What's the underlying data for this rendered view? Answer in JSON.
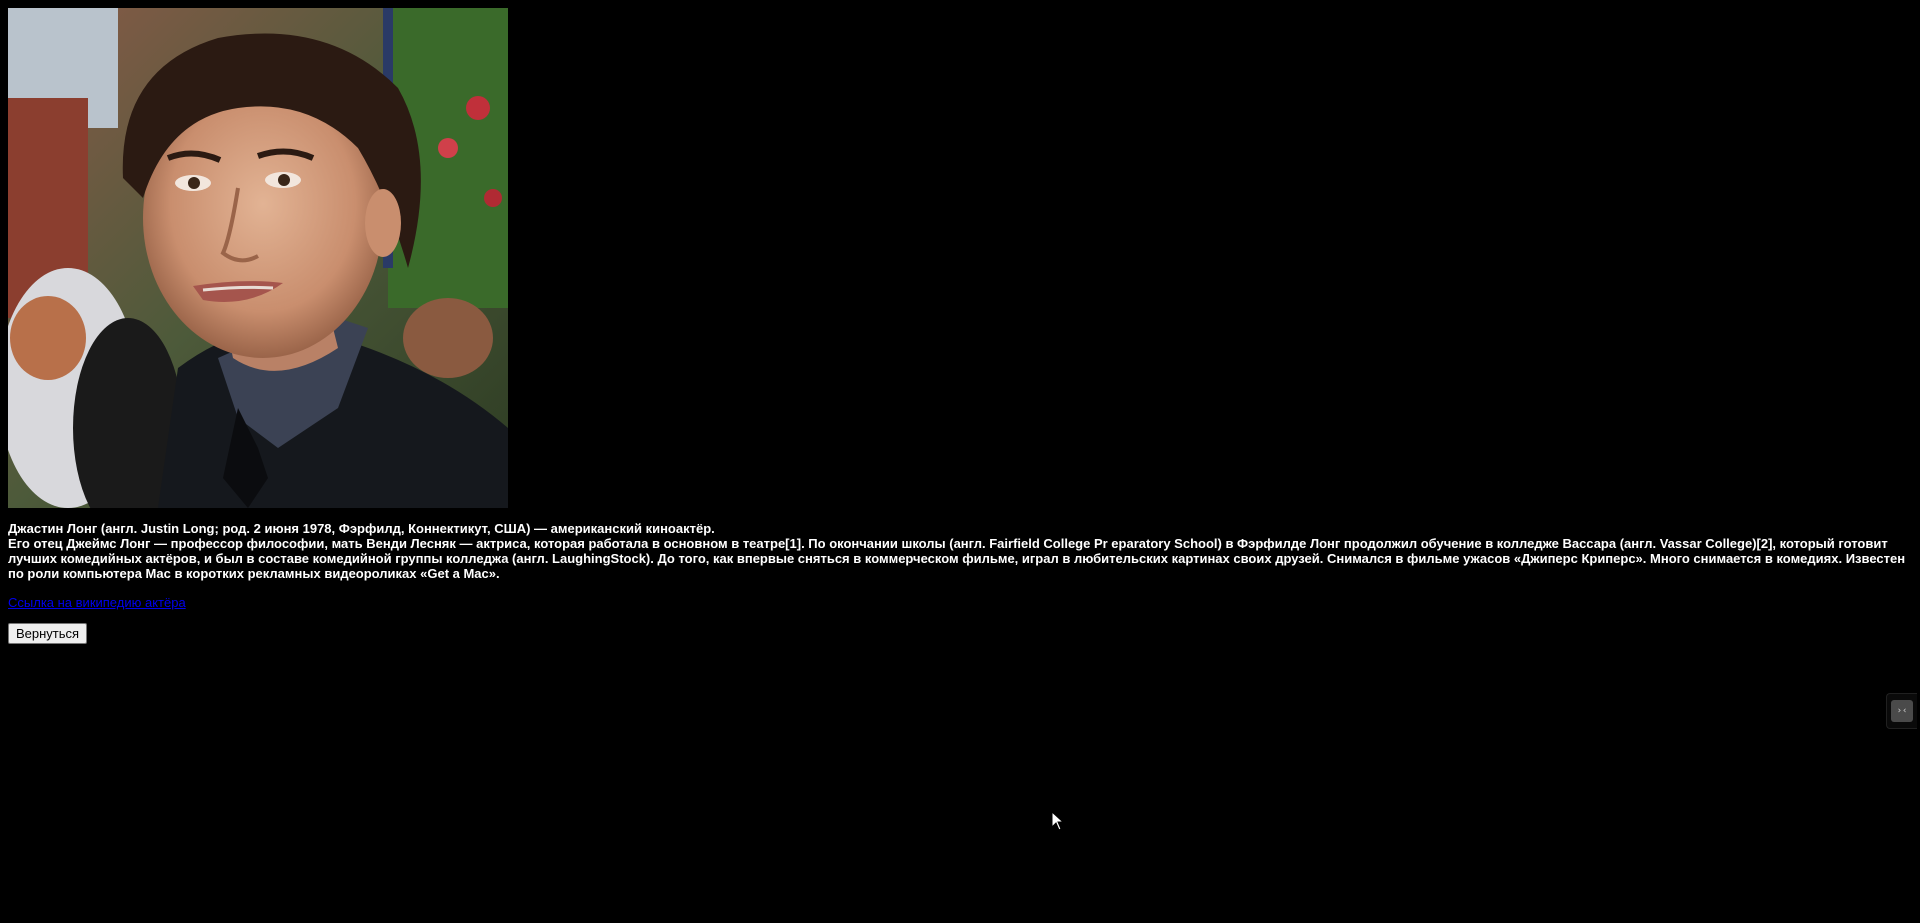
{
  "portrait": {
    "icon": "person-photo",
    "alt": ""
  },
  "bio": {
    "intro": "Джастин Лонг (англ. Justin Long; род. 2 июня 1978, Фэрфилд, Коннектикут, США) — американский киноактёр.",
    "body": "Его отец Джеймс Лонг — профессор философии, мать Венди Лесняк — актриса, которая работала в основном в театре[1]. По окончании школы (англ. Fairfield College Pr eparatory School) в Фэрфилде Лонг продолжил обучение в колледже Вассара (англ. Vassar College)[2], который готовит лучших комедийных актёров, и был в составе комедийной группы колледжа (англ. LaughingStock). До того, как впервые сняться в коммерческом фильме, играл в любительских картинах своих друзей. Снимался в фильме ужасов «Джиперс Криперс». Много снимается в комедиях. Известен по роли компьютера Mac в коротких рекламных видеороликах «Get a Mac»."
  },
  "links": {
    "wiki_label": "Ссылка на википедию актёра"
  },
  "buttons": {
    "back_label": "Вернуться"
  },
  "extension_widget": {
    "icon": "extension-icon",
    "glyph": "›‹"
  },
  "colors": {
    "background": "#000000",
    "text": "#ffffff",
    "link": "#0000ee"
  }
}
